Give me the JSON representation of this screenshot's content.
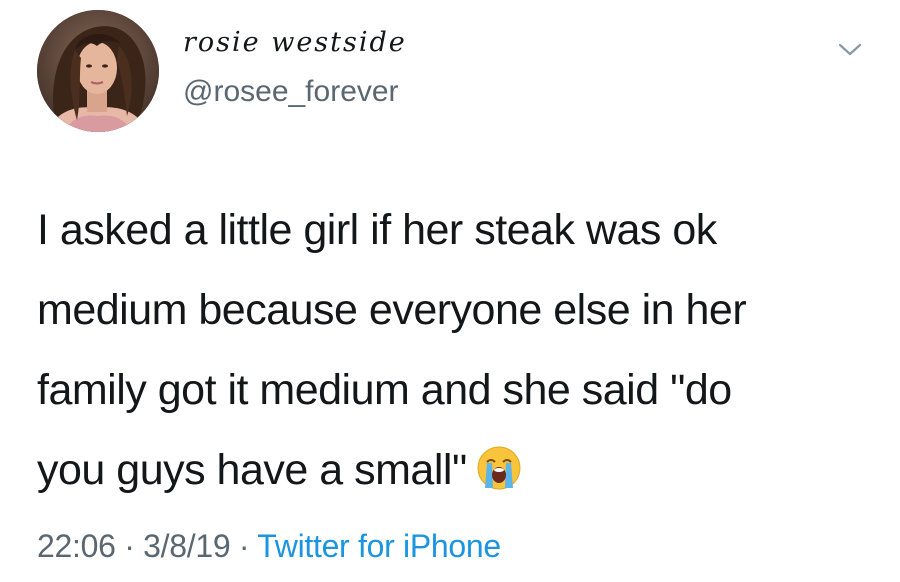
{
  "author": {
    "display_name": "rosie westside",
    "handle": "@rosee_forever",
    "avatar_icon": "profile-photo"
  },
  "menu": {
    "icon": "chevron-down-icon"
  },
  "tweet": {
    "lines": [
      "I asked a little girl if her steak was ok",
      "medium because everyone else in her",
      "family got it medium and she said \"do",
      "you guys have a small\""
    ],
    "emoji": "loudly-crying-face"
  },
  "meta": {
    "time": "22:06",
    "separator": "·",
    "date": "3/8/19",
    "source": "Twitter for iPhone"
  },
  "colors": {
    "text": "#14171a",
    "secondary": "#5b6770",
    "link": "#1b95e0",
    "background": "#ffffff"
  }
}
